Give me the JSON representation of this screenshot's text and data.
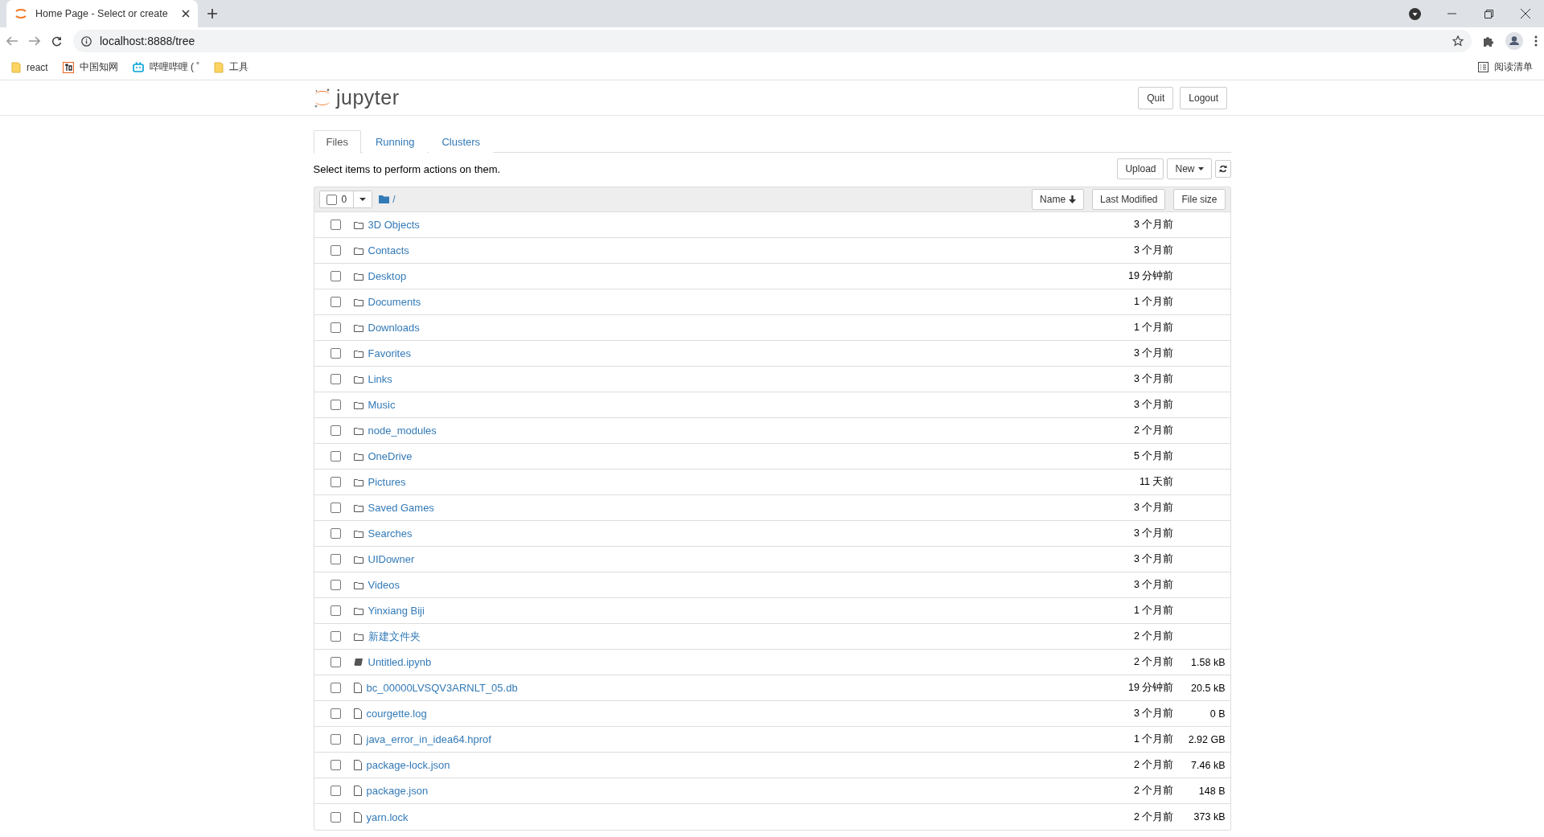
{
  "browser": {
    "tab_title": "Home Page - Select or create",
    "url": "localhost:8888/tree",
    "bookmarks": [
      {
        "label": "react",
        "kind": "folder"
      },
      {
        "label": "中国知网",
        "kind": "zhi"
      },
      {
        "label": "哔哩哔哩 ( ˚",
        "kind": "tv"
      },
      {
        "label": "工具",
        "kind": "folder"
      }
    ],
    "reading_list": "阅读清单"
  },
  "app": {
    "brand": "jupyter",
    "header_buttons": [
      "Quit",
      "Logout"
    ],
    "tabs": [
      {
        "label": "Files",
        "selected": true
      },
      {
        "label": "Running",
        "selected": false
      },
      {
        "label": "Clusters",
        "selected": false
      }
    ],
    "instruction": "Select items to perform actions on them.",
    "toolbar_buttons": [
      "Upload",
      "New"
    ],
    "list": {
      "select_count": "0",
      "select_all_checked": false,
      "breadcrumb": "/",
      "sort_buttons": [
        "Name",
        "Last Modified",
        "File size"
      ],
      "items": [
        {
          "kind": "folder",
          "name": "3D Objects",
          "modified": "3 个月前",
          "checked": false
        },
        {
          "kind": "folder",
          "name": "Contacts",
          "modified": "3 个月前",
          "checked": false
        },
        {
          "kind": "folder",
          "name": "Desktop",
          "modified": "19 分钟前",
          "checked": false
        },
        {
          "kind": "folder",
          "name": "Documents",
          "modified": "1 个月前",
          "checked": false
        },
        {
          "kind": "folder",
          "name": "Downloads",
          "modified": "1 个月前",
          "checked": false
        },
        {
          "kind": "folder",
          "name": "Favorites",
          "modified": "3 个月前",
          "checked": false
        },
        {
          "kind": "folder",
          "name": "Links",
          "modified": "3 个月前",
          "checked": false
        },
        {
          "kind": "folder",
          "name": "Music",
          "modified": "3 个月前",
          "checked": false
        },
        {
          "kind": "folder",
          "name": "node_modules",
          "modified": "2 个月前",
          "checked": false
        },
        {
          "kind": "folder",
          "name": "OneDrive",
          "modified": "5 个月前",
          "checked": false
        },
        {
          "kind": "folder",
          "name": "Pictures",
          "modified": "11 天前",
          "checked": false
        },
        {
          "kind": "folder",
          "name": "Saved Games",
          "modified": "3 个月前",
          "checked": false
        },
        {
          "kind": "folder",
          "name": "Searches",
          "modified": "3 个月前",
          "checked": false
        },
        {
          "kind": "folder",
          "name": "UIDowner",
          "modified": "3 个月前",
          "checked": false
        },
        {
          "kind": "folder",
          "name": "Videos",
          "modified": "3 个月前",
          "checked": false
        },
        {
          "kind": "folder",
          "name": "Yinxiang Biji",
          "modified": "1 个月前",
          "checked": false
        },
        {
          "kind": "folder",
          "name": "新建文件夹",
          "modified": "2 个月前",
          "checked": false
        },
        {
          "kind": "notebook",
          "name": "Untitled.ipynb",
          "modified": "2 个月前",
          "size": "1.58 kB",
          "checked": false
        },
        {
          "kind": "file",
          "name": "bc_00000LVSQV3ARNLT_05.db",
          "modified": "19 分钟前",
          "size": "20.5 kB",
          "checked": false
        },
        {
          "kind": "file",
          "name": "courgette.log",
          "modified": "3 个月前",
          "size": "0 B",
          "checked": false
        },
        {
          "kind": "file",
          "name": "java_error_in_idea64.hprof",
          "modified": "1 个月前",
          "size": "2.92 GB",
          "checked": false
        },
        {
          "kind": "file",
          "name": "package-lock.json",
          "modified": "2 个月前",
          "size": "7.46 kB",
          "checked": false
        },
        {
          "kind": "file",
          "name": "package.json",
          "modified": "2 个月前",
          "size": "148 B",
          "checked": false
        },
        {
          "kind": "file",
          "name": "yarn.lock",
          "modified": "2 个月前",
          "size": "373 kB",
          "checked": false
        }
      ]
    }
  }
}
